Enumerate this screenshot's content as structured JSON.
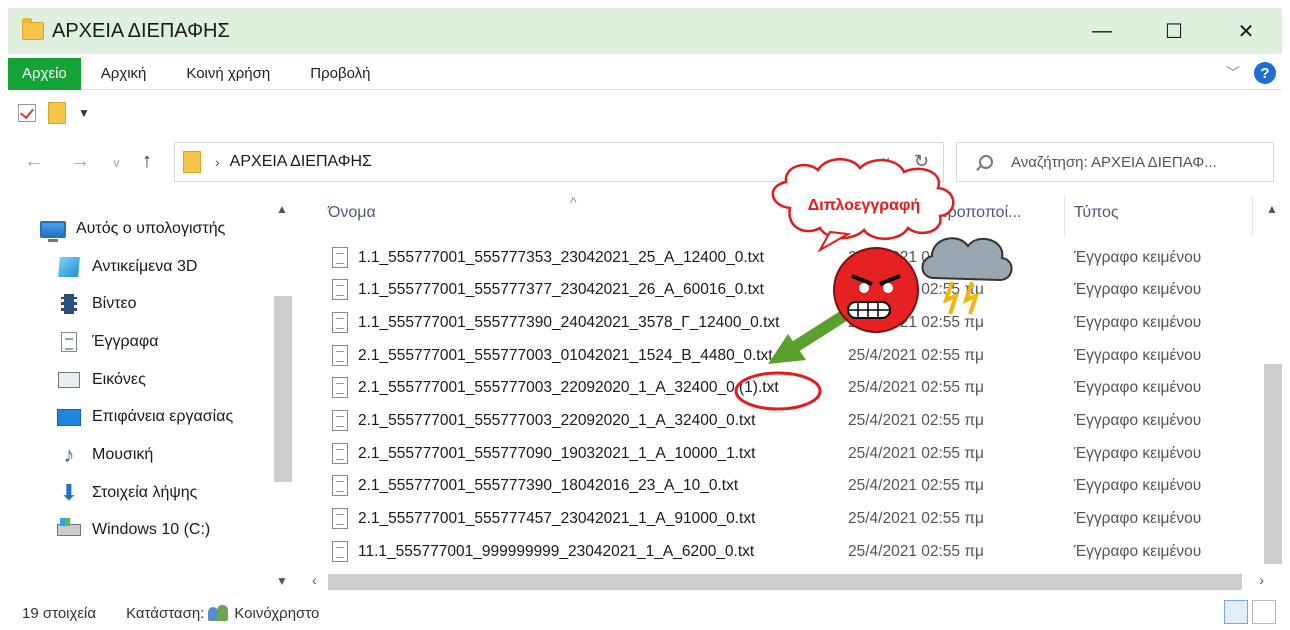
{
  "window": {
    "title": "ΑΡΧΕΙΑ ΔΙΕΠΑΦΗΣ",
    "minimize": "—",
    "maximize": "☐",
    "close": "✕"
  },
  "ribbon": {
    "tabs": [
      "Αρχείο",
      "Αρχική",
      "Κοινή χρήση",
      "Προβολή"
    ],
    "help": "?"
  },
  "address": {
    "path": "ΑΡΧΕΙΑ ΔΙΕΠΑΦΗΣ",
    "search_placeholder": "Αναζήτηση: ΑΡΧΕΙΑ ΔΙΕΠΑΦ..."
  },
  "sidebar": {
    "items": [
      {
        "label": "Αυτός ο υπολογιστής",
        "icon": "computer-icon"
      },
      {
        "label": "Αντικείμενα 3D",
        "icon": "objects-3d-icon"
      },
      {
        "label": "Βίντεο",
        "icon": "video-icon"
      },
      {
        "label": "Έγγραφα",
        "icon": "documents-icon"
      },
      {
        "label": "Εικόνες",
        "icon": "pictures-icon"
      },
      {
        "label": "Επιφάνεια εργασίας",
        "icon": "desktop-icon"
      },
      {
        "label": "Μουσική",
        "icon": "music-icon"
      },
      {
        "label": "Στοιχεία λήψης",
        "icon": "downloads-icon"
      },
      {
        "label": "Windows 10 (C:)",
        "icon": "drive-icon"
      }
    ]
  },
  "columns": {
    "name": "Όνομα",
    "modified": "Ημερομηνία τροποποί...",
    "type": "Τύπος"
  },
  "files": [
    {
      "name": "1.1_555777001_555777353_23042021_25_Α_12400_0.txt",
      "date": "25/4/2021 02:55 πμ",
      "type": "Έγγραφο κειμένου"
    },
    {
      "name": "1.1_555777001_555777377_23042021_26_Α_60016_0.txt",
      "date": "25/4/2021 02:55 πμ",
      "type": "Έγγραφο κειμένου"
    },
    {
      "name": "1.1_555777001_555777390_24042021_3578_Γ_12400_0.txt",
      "date": "25/4/2021 02:55 πμ",
      "type": "Έγγραφο κειμένου"
    },
    {
      "name": "2.1_555777001_555777003_01042021_1524_Β_4480_0.txt",
      "date": "25/4/2021 02:55 πμ",
      "type": "Έγγραφο κειμένου"
    },
    {
      "name": "2.1_555777001_555777003_22092020_1_Α_32400_0 (1).txt",
      "date": "25/4/2021 02:55 πμ",
      "type": "Έγγραφο κειμένου"
    },
    {
      "name": "2.1_555777001_555777003_22092020_1_Α_32400_0.txt",
      "date": "25/4/2021 02:55 πμ",
      "type": "Έγγραφο κειμένου"
    },
    {
      "name": "2.1_555777001_555777090_19032021_1_Α_10000_1.txt",
      "date": "25/4/2021 02:55 πμ",
      "type": "Έγγραφο κειμένου"
    },
    {
      "name": "2.1_555777001_555777390_18042016_23_Α_10_0.txt",
      "date": "25/4/2021 02:55 πμ",
      "type": "Έγγραφο κειμένου"
    },
    {
      "name": "2.1_555777001_555777457_23042021_1_Α_91000_0.txt",
      "date": "25/4/2021 02:55 πμ",
      "type": "Έγγραφο κειμένου"
    },
    {
      "name": "11.1_555777001_999999999_23042021_1_Α_6200_0.txt",
      "date": "25/4/2021 02:55 πμ",
      "type": "Έγγραφο κειμένου"
    }
  ],
  "status": {
    "count": "19 στοιχεία",
    "state": "Κατάσταση:",
    "shared": "Κοινόχρηστο"
  },
  "annotation": {
    "callout": "Διπλοεγγραφή",
    "accent": "#e21b1b",
    "arrow_color": "#5aa02c"
  }
}
